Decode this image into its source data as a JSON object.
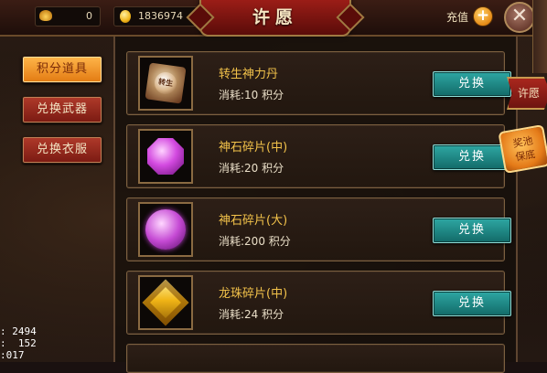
{
  "header": {
    "title": "许愿",
    "gold_ingot": "0",
    "coins": "1836974",
    "recharge_label": "充值",
    "plus_symbol": "+",
    "close_symbol": "✕"
  },
  "tabs": [
    {
      "label": "积分道具",
      "active": true
    },
    {
      "label": "兑换武器",
      "active": false
    },
    {
      "label": "兑换衣服",
      "active": false
    }
  ],
  "items": [
    {
      "name": "转生神力丹",
      "cost": "消耗:10 积分",
      "button": "兑换",
      "icon": "pill-icon",
      "icon_text": "转生"
    },
    {
      "name": "神石碎片(中)",
      "cost": "消耗:20 积分",
      "button": "兑换",
      "icon": "gem-mid-icon"
    },
    {
      "name": "神石碎片(大)",
      "cost": "消耗:200 积分",
      "button": "兑换",
      "icon": "gem-big-icon"
    },
    {
      "name": "龙珠碎片(中)",
      "cost": "消耗:24 积分",
      "button": "兑换",
      "icon": "dragon-icon"
    }
  ],
  "side_tabs": {
    "wish": "许愿",
    "pool_line1": "奖池",
    "pool_line2": "保底"
  },
  "debug": {
    "line1": ": 2494",
    "line2": ":  152",
    "line3": ":017"
  }
}
